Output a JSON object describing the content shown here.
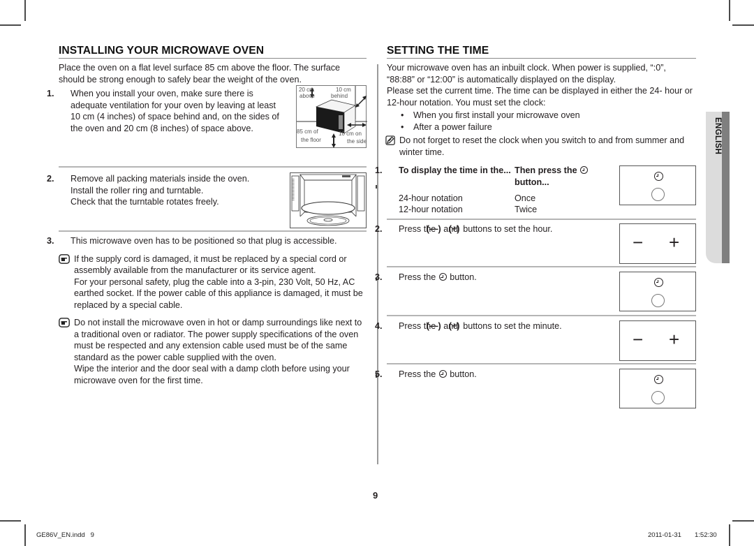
{
  "left": {
    "title": "INSTALLING YOUR MICROWAVE OVEN",
    "intro": "Place the oven on a flat level surface 85 cm above the floor. The surface should be strong enough to safely bear the weight of the oven.",
    "steps": [
      {
        "num": "1.",
        "text": "When you install your oven, make sure there is adequate ventilation for your oven by leaving at least 10 cm (4 inches) of space behind and, on the sides of the oven and 20 cm (8 inches) of space above.",
        "figure_labels": {
          "above": "20 cm above",
          "behind": "10 cm behind",
          "floor": "85 cm of the floor",
          "side": "10 cm on the side"
        }
      },
      {
        "num": "2.",
        "lines": [
          "Remove all packing materials inside the oven.",
          "Install the roller ring and turntable.",
          "Check that the turntable rotates freely."
        ]
      },
      {
        "num": "3.",
        "text": "This microwave oven has to be positioned so that plug is accessible."
      }
    ],
    "notices": [
      {
        "icon": "pointing-hand-icon",
        "lines": [
          "If the supply cord is damaged, it must be replaced by a special cord or assembly available from the manufacturer or its service agent.",
          "For your personal safety, plug the cable into a 3-pin, 230 Volt, 50 Hz, AC earthed socket. If the power cable of this appliance is damaged, it must be replaced by a special cable."
        ]
      },
      {
        "icon": "pointing-hand-icon",
        "lines": [
          "Do not install the microwave oven in hot or damp surroundings like next to a traditional oven or radiator. The power supply specifications of the oven must be respected and any extension cable used must be of the same standard as the power cable supplied with the oven.",
          "Wipe the interior and the door seal with a damp cloth before using your microwave oven for the first time."
        ]
      }
    ]
  },
  "right": {
    "title": "SETTING THE TIME",
    "intro": [
      "Your microwave oven has an inbuilt clock. When power is supplied, “:0”, “88:88” or “12:00” is automatically displayed on the display.",
      "Please set the current time. The time can be displayed in either the 24- hour or 12-hour notation. You must set the clock:"
    ],
    "bullets": [
      "When you first install your microwave oven",
      "After a power failure"
    ],
    "note": "Do not forget to reset the clock when you switch to and from summer and winter time.",
    "steps": [
      {
        "num": "1.",
        "col1_head": "To display the time in the...",
        "col2_head_a": "Then press the",
        "col2_head_b": "button...",
        "rows": [
          {
            "notation": "24-hour notation",
            "press": "Once"
          },
          {
            "notation": "12-hour notation",
            "press": "Twice"
          }
        ],
        "panel": "clock"
      },
      {
        "num": "2.",
        "text_a": "Press the",
        "minus": "(—)",
        "and": "and",
        "plus": "(+)",
        "text_b": "buttons to set the hour.",
        "panel": "minus-plus"
      },
      {
        "num": "3.",
        "text_a": "Press the",
        "text_b": "button.",
        "panel": "clock"
      },
      {
        "num": "4.",
        "text_a": "Press the",
        "minus": "(—)",
        "and": "and",
        "plus": "(+)",
        "text_b": "buttons to set the minute.",
        "panel": "minus-plus"
      },
      {
        "num": "5.",
        "text_a": "Press the",
        "text_b": "button.",
        "panel": "clock"
      }
    ],
    "panel_minus": "−",
    "panel_plus": "+"
  },
  "side_tab": "ENGLISH",
  "page_number": "9",
  "footer": {
    "file": "GE86V_EN.indd   9",
    "date": "2011-01-31",
    "time": "1:52:30"
  }
}
